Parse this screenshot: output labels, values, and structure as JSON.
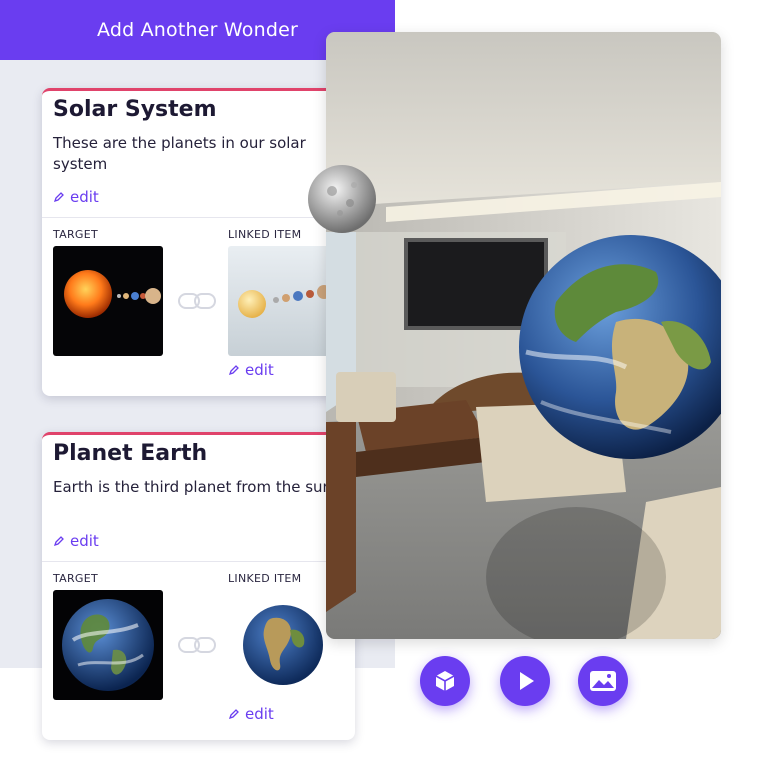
{
  "add_button": {
    "label": "Add Another Wonder"
  },
  "cards": [
    {
      "title": "Solar System",
      "description": "These are the planets in our solar system",
      "edit_label": "edit",
      "target_label": "TARGET",
      "linked_label": "LINKED ITEM",
      "linked_edit_label": "edit",
      "target_icon": "solar-system-image",
      "linked_icon": "solar-system-model"
    },
    {
      "title": "Planet Earth",
      "description": "Earth is the third planet from the sun",
      "edit_label": "edit",
      "target_label": "TARGET",
      "linked_label": "LINKED ITEM",
      "linked_edit_label": "edit",
      "target_icon": "earth-image",
      "linked_icon": "earth-model"
    }
  ],
  "controls": [
    {
      "icon": "cube-icon"
    },
    {
      "icon": "play-icon"
    },
    {
      "icon": "image-icon"
    }
  ],
  "colors": {
    "accent": "#6a3df0",
    "card_top": "#e0436b",
    "panel": "#e9ebf2"
  }
}
